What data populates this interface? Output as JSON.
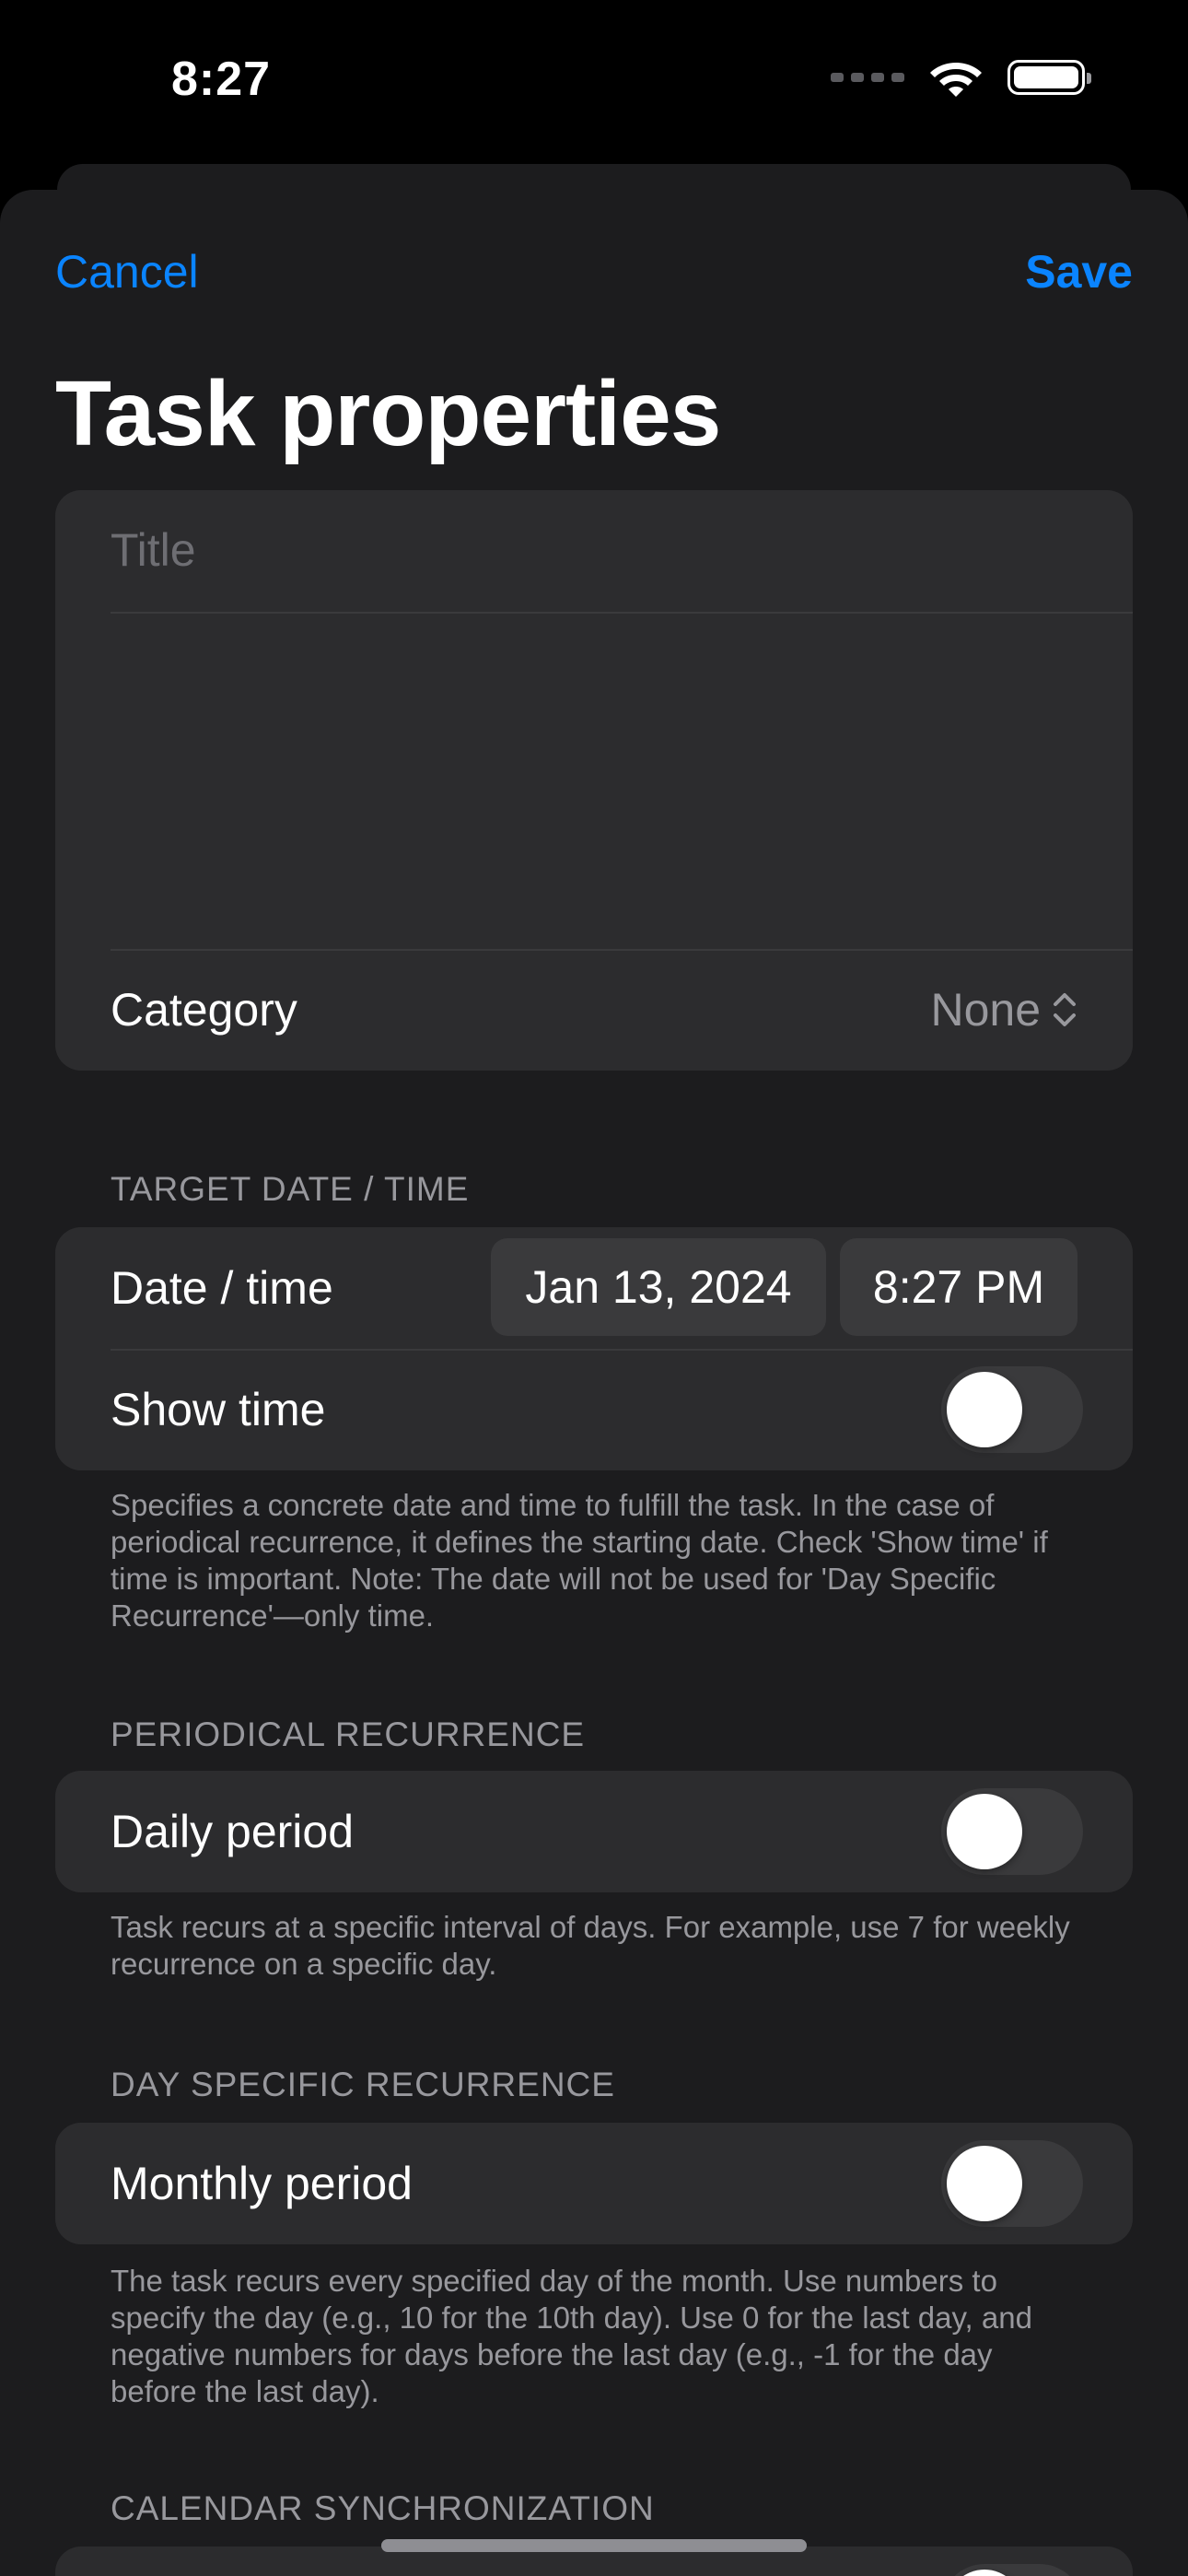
{
  "status_bar": {
    "time": "8:27",
    "icons": [
      "cellular-signal-icon",
      "wifi-icon",
      "battery-icon"
    ]
  },
  "nav": {
    "cancel_label": "Cancel",
    "save_label": "Save"
  },
  "title": "Task properties",
  "form": {
    "title_placeholder": "Title",
    "notes_value": "",
    "category_label": "Category",
    "category_value": "None"
  },
  "target_date": {
    "header": "TARGET DATE / TIME",
    "date_time_label": "Date / time",
    "date_value": "Jan 13, 2024",
    "time_value": "8:27 PM",
    "show_time_label": "Show time",
    "show_time_on": false,
    "footnote": "Specifies a concrete date and time to fulfill the task. In the case of periodical recurrence, it defines the starting date. Check 'Show time' if time is important. Note: The date will not be used for 'Day Specific Recurrence'—only time."
  },
  "periodical": {
    "header": "PERIODICAL RECURRENCE",
    "daily_label": "Daily period",
    "daily_on": false,
    "footnote": "Task recurs at a specific interval of days. For example, use 7 for weekly recurrence on a specific day."
  },
  "day_specific": {
    "header": "DAY SPECIFIC RECURRENCE",
    "monthly_label": "Monthly period",
    "monthly_on": false,
    "footnote": "The task recurs every specified day of the month. Use numbers to specify the day (e.g., 10 for the 10th day). Use 0 for the last day, and negative numbers for days before the last day (e.g., -1 for the day before the last day)."
  },
  "calendar": {
    "header": "CALENDAR SYNCHRONIZATION"
  },
  "colors": {
    "accent": "#0a84ff",
    "background": "#1c1c1e",
    "card": "#2c2c2e",
    "secondary_text": "#98989d"
  }
}
